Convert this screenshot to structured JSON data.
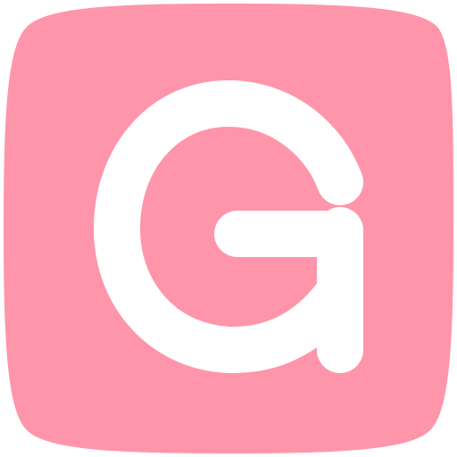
{
  "icon": {
    "name": "letter-g-app-icon",
    "glyph": "G",
    "colors": {
      "tile": "#FF95AA",
      "glyph": "#FFFFFF"
    }
  }
}
